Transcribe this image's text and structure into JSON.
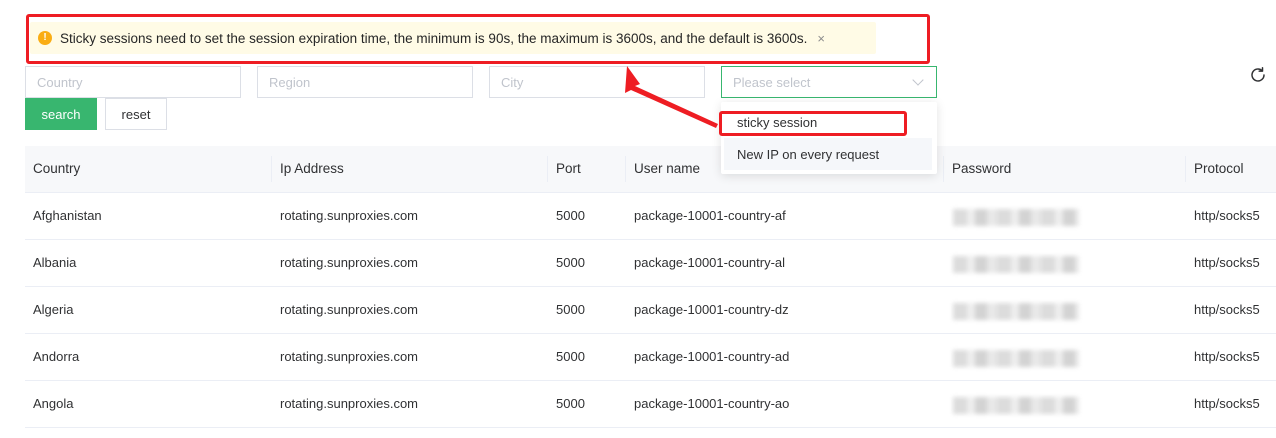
{
  "notice": {
    "text": "Sticky sessions need to set the session expiration time, the minimum is 90s, the maximum is 3600s, and the default is 3600s.",
    "close_glyph": "×",
    "warning_glyph": "!",
    "icon": "warning-circle-icon"
  },
  "filters": {
    "country_placeholder": "Country",
    "region_placeholder": "Region",
    "city_placeholder": "City",
    "session_placeholder": "Please select",
    "search_label": "search",
    "reset_label": "reset"
  },
  "dropdown": {
    "options": [
      "sticky session",
      "New IP on every request"
    ]
  },
  "table": {
    "columns": [
      "Country",
      "Ip Address",
      "Port",
      "User name",
      "Password",
      "Protocol"
    ],
    "rows": [
      {
        "country": "Afghanistan",
        "ip": "rotating.sunproxies.com",
        "port": "5000",
        "user": "package-10001-country-af",
        "protocol": "http/socks5"
      },
      {
        "country": "Albania",
        "ip": "rotating.sunproxies.com",
        "port": "5000",
        "user": "package-10001-country-al",
        "protocol": "http/socks5"
      },
      {
        "country": "Algeria",
        "ip": "rotating.sunproxies.com",
        "port": "5000",
        "user": "package-10001-country-dz",
        "protocol": "http/socks5"
      },
      {
        "country": "Andorra",
        "ip": "rotating.sunproxies.com",
        "port": "5000",
        "user": "package-10001-country-ad",
        "protocol": "http/socks5"
      },
      {
        "country": "Angola",
        "ip": "rotating.sunproxies.com",
        "port": "5000",
        "user": "package-10001-country-ao",
        "protocol": "http/socks5"
      }
    ]
  },
  "colors": {
    "primary": "#38b66f",
    "annotation": "#ee1d23",
    "notice_bg": "#fffbe6",
    "warning": "#faad14"
  }
}
